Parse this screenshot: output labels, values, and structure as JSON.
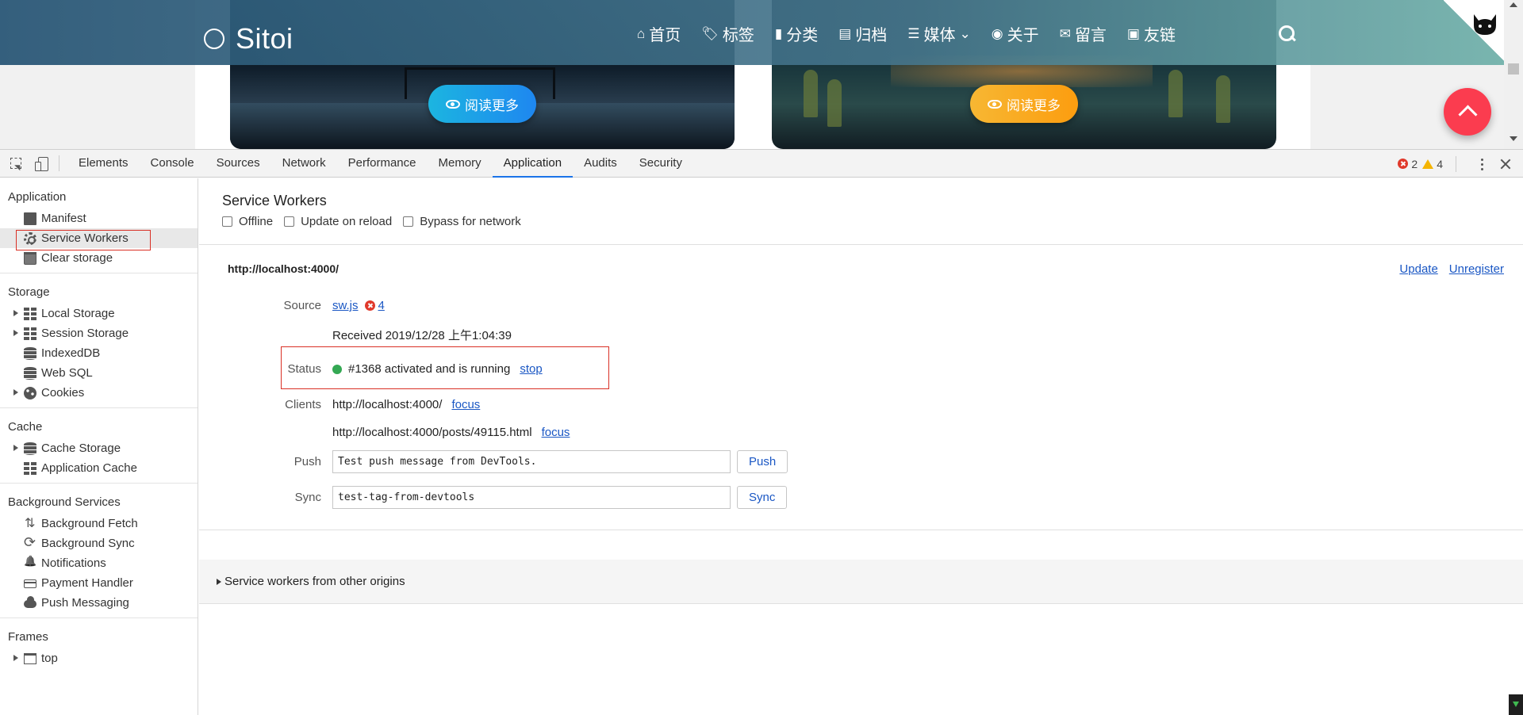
{
  "site": {
    "brand": "Sitoi",
    "nav": [
      {
        "label": "首页",
        "icon": "home-icon",
        "glyph": "⌂"
      },
      {
        "label": "标签",
        "icon": "tags-icon",
        "glyph": "🏷"
      },
      {
        "label": "分类",
        "icon": "bookmark-icon",
        "glyph": "▮"
      },
      {
        "label": "归档",
        "icon": "archive-icon",
        "glyph": "▤"
      },
      {
        "label": "媒体",
        "icon": "list-icon",
        "glyph": "☰"
      },
      {
        "label": "关于",
        "icon": "user-circle-icon",
        "glyph": "◉"
      },
      {
        "label": "留言",
        "icon": "envelope-icon",
        "glyph": "✉"
      },
      {
        "label": "友链",
        "icon": "address-card-icon",
        "glyph": "▣"
      }
    ],
    "read_more": "阅读更多",
    "colors": {
      "nav_start": "#265474",
      "nav_end": "#70b2aa",
      "fab": "#fb3c4f",
      "btn1": "#1e87f0",
      "btn2": "#fc9d0f"
    }
  },
  "devtools": {
    "tabs": [
      "Elements",
      "Console",
      "Sources",
      "Network",
      "Performance",
      "Memory",
      "Application",
      "Audits",
      "Security"
    ],
    "active_tab": "Application",
    "errors": "2",
    "warnings": "4",
    "sidebar": {
      "application": {
        "title": "Application",
        "items": [
          "Manifest",
          "Service Workers",
          "Clear storage"
        ]
      },
      "storage": {
        "title": "Storage",
        "items": [
          "Local Storage",
          "Session Storage",
          "IndexedDB",
          "Web SQL",
          "Cookies"
        ]
      },
      "cache": {
        "title": "Cache",
        "items": [
          "Cache Storage",
          "Application Cache"
        ]
      },
      "background": {
        "title": "Background Services",
        "items": [
          "Background Fetch",
          "Background Sync",
          "Notifications",
          "Payment Handler",
          "Push Messaging"
        ]
      },
      "frames": {
        "title": "Frames",
        "items": [
          "top"
        ]
      }
    },
    "sw": {
      "title": "Service Workers",
      "checks": [
        "Offline",
        "Update on reload",
        "Bypass for network"
      ],
      "origin": "http://localhost:4000/",
      "update": "Update",
      "unregister": "Unregister",
      "source_label": "Source",
      "source_file": "sw.js",
      "source_errors": "4",
      "received": "Received 2019/12/28 上午1:04:39",
      "status_label": "Status",
      "status_text": "#1368 activated and is running",
      "stop": "stop",
      "clients_label": "Clients",
      "clients": [
        {
          "url": "http://localhost:4000/",
          "action": "focus"
        },
        {
          "url": "http://localhost:4000/posts/49115.html",
          "action": "focus"
        }
      ],
      "push_label": "Push",
      "push_value": "Test push message from DevTools.",
      "push_button": "Push",
      "sync_label": "Sync",
      "sync_value": "test-tag-from-devtools",
      "sync_button": "Sync",
      "other_origins": "Service workers from other origins",
      "status_color": "#34a853",
      "highlight_color": "#d93025"
    }
  }
}
